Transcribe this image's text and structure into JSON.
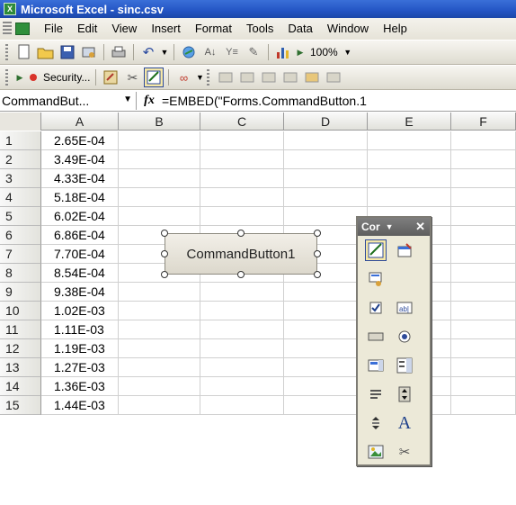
{
  "window": {
    "title": "Microsoft Excel - sinc.csv"
  },
  "menu": [
    "File",
    "Edit",
    "View",
    "Insert",
    "Format",
    "Tools",
    "Data",
    "Window",
    "Help"
  ],
  "toolbar": {
    "zoom": "100%",
    "security_label": "Security..."
  },
  "formula_bar": {
    "name_box": "CommandBut...",
    "fx": "fx",
    "formula": "=EMBED(\"Forms.CommandButton.1"
  },
  "columns": [
    "A",
    "B",
    "C",
    "D",
    "E",
    "F"
  ],
  "rows": [
    {
      "num": "1",
      "a": "2.65E-04"
    },
    {
      "num": "2",
      "a": "3.49E-04"
    },
    {
      "num": "3",
      "a": "4.33E-04"
    },
    {
      "num": "4",
      "a": "5.18E-04"
    },
    {
      "num": "5",
      "a": "6.02E-04"
    },
    {
      "num": "6",
      "a": "6.86E-04"
    },
    {
      "num": "7",
      "a": "7.70E-04"
    },
    {
      "num": "8",
      "a": "8.54E-04"
    },
    {
      "num": "9",
      "a": "9.38E-04"
    },
    {
      "num": "10",
      "a": "1.02E-03"
    },
    {
      "num": "11",
      "a": "1.11E-03"
    },
    {
      "num": "12",
      "a": "1.19E-03"
    },
    {
      "num": "13",
      "a": "1.27E-03"
    },
    {
      "num": "14",
      "a": "1.36E-03"
    },
    {
      "num": "15",
      "a": "1.44E-03"
    }
  ],
  "command_button": {
    "label": "CommandButton1"
  },
  "controls_toolbox": {
    "title": "Cor"
  }
}
